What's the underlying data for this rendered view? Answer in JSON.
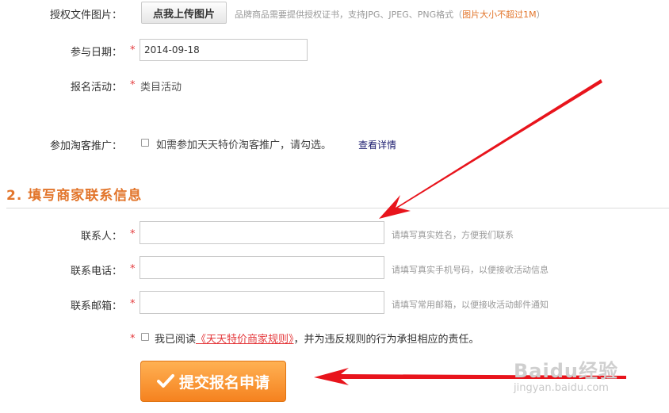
{
  "upload": {
    "label": "授权文件图片：",
    "button": "点我上传图片",
    "hint": "品牌商品需要提供授权证书，支持JPG、JPEG、PNG格式（",
    "hint_warn": "图片大小不超过1M",
    "hint_end": "）"
  },
  "date": {
    "label": "参与日期：",
    "value": "2014-09-18"
  },
  "activity": {
    "label": "报名活动：",
    "value": "类目活动"
  },
  "taoke": {
    "label": "参加淘客推广：",
    "checkbox_text": "如需参加天天特价淘客推广，请勾选。",
    "detail_link": "查看详情"
  },
  "section": {
    "title": "2. 填写商家联系信息"
  },
  "contact": {
    "name_label": "联系人：",
    "name_hint": "请填写真实姓名，方便我们联系",
    "phone_label": "联系电话：",
    "phone_hint": "请填写真实手机号码，以便接收活动信息",
    "email_label": "联系邮箱：",
    "email_hint": "请填写常用邮箱，以便接收活动邮件通知"
  },
  "required_mark": "*",
  "agree": {
    "prefix": "我已阅读",
    "link": "《天天特价商家规则》",
    "suffix": "，并为违反规则的行为承担相应的责任。"
  },
  "submit": {
    "label": "提交报名申请"
  },
  "watermark": {
    "brand": "Baidu经验",
    "url": "jingyan.baidu.com"
  },
  "colors": {
    "accent": "#f5821f",
    "required": "#e4393c",
    "arrow": "#e8141c",
    "section": "#e2752b"
  }
}
